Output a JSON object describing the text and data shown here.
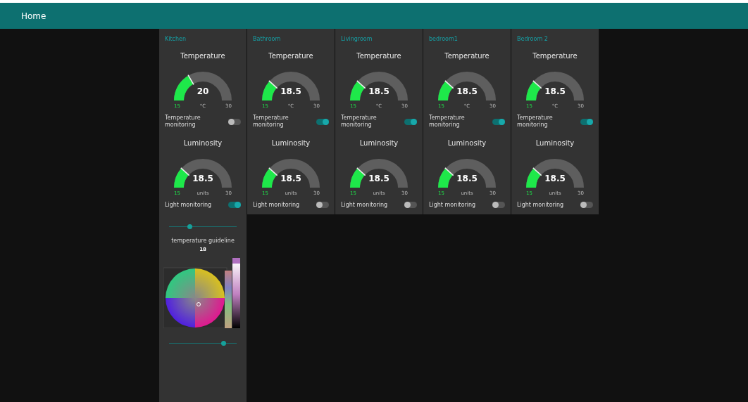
{
  "header": {
    "title": "Home"
  },
  "rooms": [
    {
      "name": "Kitchen",
      "gauges": [
        {
          "title": "Temperature",
          "value": "20",
          "unit": "°C",
          "min": "15",
          "max": "30"
        },
        {
          "title": "Luminosity",
          "value": "18.5",
          "unit": "units",
          "min": "15",
          "max": "30"
        }
      ],
      "temp_monitoring": {
        "label": "Temperature monitoring",
        "on": false
      },
      "light_monitoring": {
        "label": "Light monitoring",
        "on": true
      },
      "extras": {
        "slider": {
          "level": 0.3
        },
        "guideline": {
          "label": "temperature guideline",
          "value": "18"
        },
        "bottom_slider": {
          "level": 0.8
        }
      }
    },
    {
      "name": "Bathroom",
      "gauges": [
        {
          "title": "Temperature",
          "value": "18.5",
          "unit": "°C",
          "min": "15",
          "max": "30"
        },
        {
          "title": "Luminosity",
          "value": "18.5",
          "unit": "units",
          "min": "15",
          "max": "30"
        }
      ],
      "temp_monitoring": {
        "label": "Temperature monitoring",
        "on": true
      },
      "light_monitoring": {
        "label": "Light monitoring",
        "on": false
      }
    },
    {
      "name": "Livingroom",
      "gauges": [
        {
          "title": "Temperature",
          "value": "18.5",
          "unit": "°C",
          "min": "15",
          "max": "30"
        },
        {
          "title": "Luminosity",
          "value": "18.5",
          "unit": "units",
          "min": "15",
          "max": "30"
        }
      ],
      "temp_monitoring": {
        "label": "Temperature monitoring",
        "on": true
      },
      "light_monitoring": {
        "label": "Light monitoring",
        "on": false
      }
    },
    {
      "name": "bedroom1",
      "gauges": [
        {
          "title": "Temperature",
          "value": "18.5",
          "unit": "°C",
          "min": "15",
          "max": "30"
        },
        {
          "title": "Luminosity",
          "value": "18.5",
          "unit": "units",
          "min": "15",
          "max": "30"
        }
      ],
      "temp_monitoring": {
        "label": "Temperature monitoring",
        "on": true
      },
      "light_monitoring": {
        "label": "Light monitoring",
        "on": false
      }
    },
    {
      "name": "Bedroom 2",
      "gauges": [
        {
          "title": "Temperature",
          "value": "18.5",
          "unit": "°C",
          "min": "15",
          "max": "30"
        },
        {
          "title": "Luminosity",
          "value": "18.5",
          "unit": "units",
          "min": "15",
          "max": "30"
        }
      ],
      "temp_monitoring": {
        "label": "Temperature monitoring",
        "on": true
      },
      "light_monitoring": {
        "label": "Light monitoring",
        "on": false
      }
    }
  ]
}
